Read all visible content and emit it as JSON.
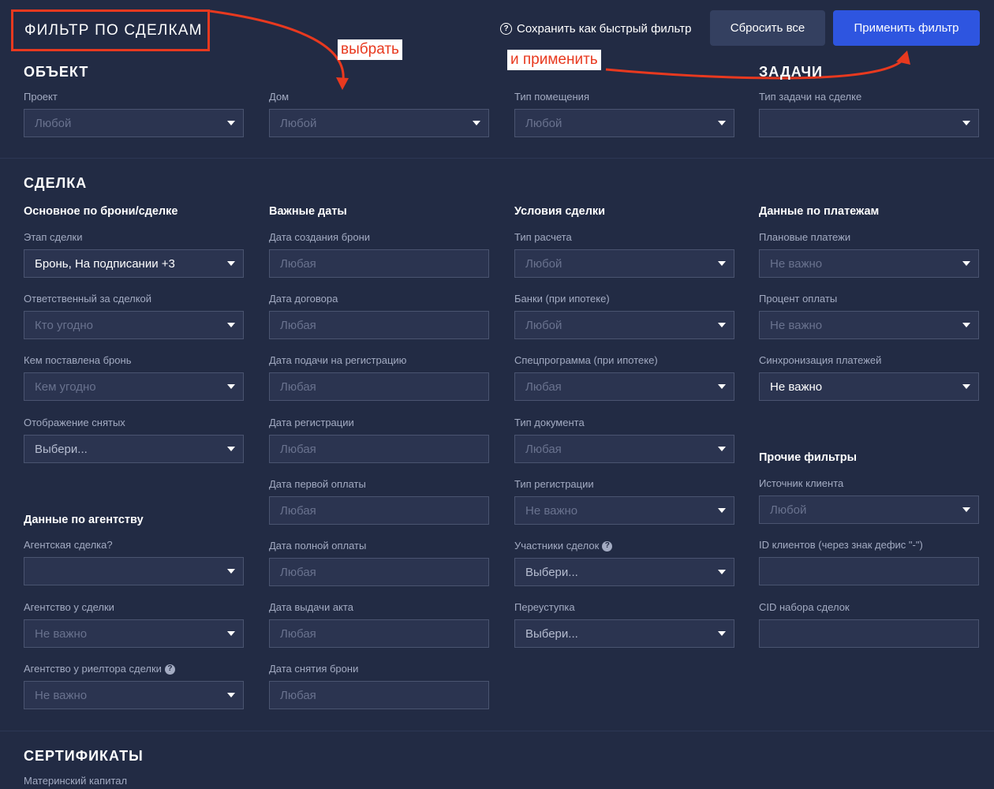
{
  "header": {
    "title": "ФИЛЬТР ПО СДЕЛКАМ",
    "save_quick_label": "Сохранить как быстрый фильтр",
    "reset_label": "Сбросить все",
    "apply_label": "Применить фильтр"
  },
  "annotations": {
    "choose": "выбрать",
    "apply": "и применить",
    "color": "#e8391f"
  },
  "sections": {
    "object": {
      "title": "ОБЪЕКТ",
      "fields": {
        "project": {
          "label": "Проект",
          "value": "Любой"
        },
        "house": {
          "label": "Дом",
          "value": "Любой"
        },
        "room_type": {
          "label": "Тип помещения",
          "value": "Любой"
        }
      }
    },
    "tasks": {
      "title": "ЗАДАЧИ",
      "fields": {
        "task_type": {
          "label": "Тип задачи на сделке",
          "value": ""
        }
      }
    },
    "deal": {
      "title": "СДЕЛКА",
      "groups": {
        "main": {
          "title": "Основное по брони/сделке",
          "fields": {
            "stage": {
              "label": "Этап сделки",
              "value": "Бронь, На подписании +3"
            },
            "responsible": {
              "label": "Ответственный за сделкой",
              "value": "Кто угодно"
            },
            "booked_by": {
              "label": "Кем поставлена бронь",
              "value": "Кем угодно"
            },
            "show_removed": {
              "label": "Отображение снятых",
              "value": "Выбери..."
            }
          }
        },
        "dates": {
          "title": "Важные даты",
          "fields": {
            "booking_created": {
              "label": "Дата создания брони",
              "placeholder": "Любая"
            },
            "contract_date": {
              "label": "Дата договора",
              "placeholder": "Любая"
            },
            "registration_submit": {
              "label": "Дата подачи на регистрацию",
              "placeholder": "Любая"
            },
            "registration_date": {
              "label": "Дата регистрации",
              "placeholder": "Любая"
            },
            "first_payment": {
              "label": "Дата первой оплаты",
              "placeholder": "Любая"
            },
            "full_payment": {
              "label": "Дата полной оплаты",
              "placeholder": "Любая"
            },
            "act_date": {
              "label": "Дата выдачи акта",
              "placeholder": "Любая"
            },
            "booking_removed": {
              "label": "Дата снятия брони",
              "placeholder": "Любая"
            }
          }
        },
        "conditions": {
          "title": "Условия сделки",
          "fields": {
            "calc_type": {
              "label": "Тип расчета",
              "value": "Любой"
            },
            "banks": {
              "label": "Банки (при ипотеке)",
              "value": "Любой"
            },
            "program": {
              "label": "Спецпрограмма (при ипотеке)",
              "value": "Любая"
            },
            "doc_type": {
              "label": "Тип документа",
              "value": "Любая"
            },
            "reg_type": {
              "label": "Тип регистрации",
              "value": "Не важно"
            },
            "participants": {
              "label": "Участники сделок",
              "value": "Выбери..."
            },
            "assignment": {
              "label": "Переуступка",
              "value": "Выбери..."
            }
          }
        },
        "payments": {
          "title": "Данные по платежам",
          "fields": {
            "planned": {
              "label": "Плановые платежи",
              "value": "Не важно"
            },
            "percent": {
              "label": "Процент оплаты",
              "value": "Не важно"
            },
            "sync": {
              "label": "Синхронизация платежей",
              "value": "Не важно"
            }
          }
        },
        "other": {
          "title": "Прочие фильтры",
          "fields": {
            "client_source": {
              "label": "Источник клиента",
              "value": "Любой"
            },
            "client_ids": {
              "label": "ID клиентов (через знак дефис \"-\")",
              "value": ""
            },
            "cid_set": {
              "label": "CID набора сделок",
              "value": ""
            }
          }
        },
        "agency": {
          "title": "Данные по агентству",
          "fields": {
            "agency_deal": {
              "label": "Агентская сделка?",
              "value": ""
            },
            "agency_at_deal": {
              "label": "Агентство у сделки",
              "value": "Не важно"
            },
            "realtor_agency": {
              "label": "Агентство у риелтора сделки",
              "value": "Не важно"
            }
          }
        }
      }
    },
    "certificates": {
      "title": "СЕРТИФИКАТЫ",
      "fields": {
        "maternity": {
          "label": "Материнский капитал"
        }
      }
    }
  }
}
